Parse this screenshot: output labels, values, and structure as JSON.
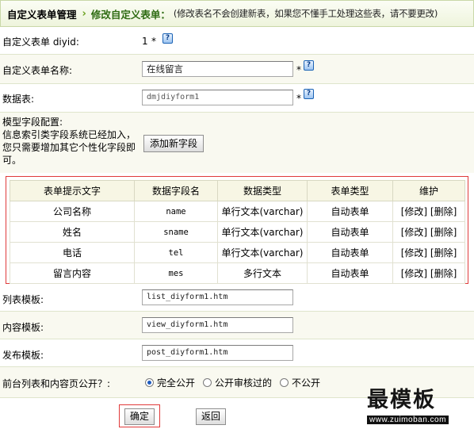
{
  "header": {
    "title": "自定义表单管理",
    "current": "修改自定义表单：",
    "note": "(修改表名不会创建新表，如果您不懂手工处理这些表，请不要更改)"
  },
  "form": {
    "diyid_label": "自定义表单 diyid:",
    "diyid_value": "1",
    "required_mark": "*",
    "name_label": "自定义表单名称:",
    "name_value": "在线留言",
    "table_label": "数据表:",
    "table_value": "dmjdiyform1",
    "model_label": "模型字段配置:",
    "model_desc": "信息索引类字段系统已经加入，您只需要增加其它个性化字段即可。",
    "add_field_button": "添加新字段",
    "help_icon": "question-help-icon"
  },
  "fields_table": {
    "headers": [
      "表单提示文字",
      "数据字段名",
      "数据类型",
      "表单类型",
      "维护"
    ],
    "rows": [
      {
        "label": "公司名称",
        "field": "name",
        "dtype": "单行文本(varchar)",
        "ftype": "自动表单",
        "edit": "[修改]",
        "del": "[删除]"
      },
      {
        "label": "姓名",
        "field": "sname",
        "dtype": "单行文本(varchar)",
        "ftype": "自动表单",
        "edit": "[修改]",
        "del": "[删除]"
      },
      {
        "label": "电话",
        "field": "tel",
        "dtype": "单行文本(varchar)",
        "ftype": "自动表单",
        "edit": "[修改]",
        "del": "[删除]"
      },
      {
        "label": "留言内容",
        "field": "mes",
        "dtype": "多行文本",
        "ftype": "自动表单",
        "edit": "[修改]",
        "del": "[删除]"
      }
    ]
  },
  "templates": {
    "list_label": "列表模板:",
    "list_value": "list_diyform1.htm",
    "view_label": "内容模板:",
    "view_value": "view_diyform1.htm",
    "post_label": "发布模板:",
    "post_value": "post_diyform1.htm"
  },
  "visibility": {
    "label": "前台列表和内容页公开？:",
    "options": [
      "完全公开",
      "公开审核过的",
      "不公开"
    ],
    "selected": "完全公开"
  },
  "actions": {
    "confirm": "确定",
    "back": "返回"
  },
  "watermark": {
    "title": "最模板",
    "url": "www.zuimoban.com"
  }
}
